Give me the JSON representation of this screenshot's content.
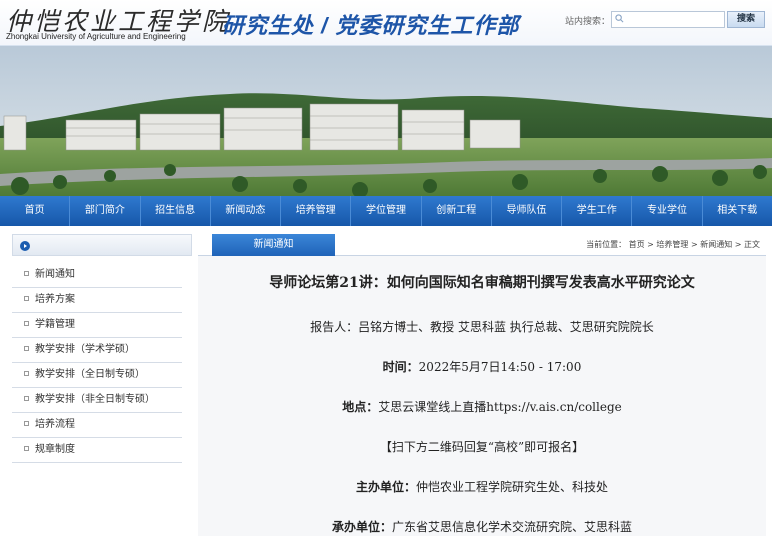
{
  "header": {
    "logo_cn": "仲恺农业工程学院",
    "logo_en": "Zhongkai University of Agriculture and Engineering",
    "site_title": "研究生处 / 党委研究生工作部",
    "search_label": "站内搜索：",
    "search_placeholder": "",
    "search_button": "搜索"
  },
  "nav": {
    "items": [
      "首页",
      "部门简介",
      "招生信息",
      "新闻动态",
      "培养管理",
      "学位管理",
      "创新工程",
      "导师队伍",
      "学生工作",
      "专业学位",
      "相关下载"
    ]
  },
  "sidebar": {
    "items": [
      "新闻通知",
      "培养方案",
      "学籍管理",
      "教学安排（学术学硕）",
      "教学安排（全日制专硕）",
      "教学安排（非全日制专硕）",
      "培养流程",
      "规章制度"
    ]
  },
  "main": {
    "tab": "新闻通知",
    "breadcrumb": "当前位置： 首页 > 培养管理 > 新闻通知 > 正文",
    "title": "导师论坛第21讲：如何向国际知名审稿期刊撰写发表高水平研究论文",
    "reporter": "报告人：吕铭方博士、教授  艾思科蓝  执行总裁、艾思研究院院长",
    "time_label": "时间：",
    "time_value": "2022年5月7日14:50 - 17:00",
    "place_label": "地点：",
    "place_value": "艾思云课堂线上直播https://v.ais.cn/college",
    "register": "【扫下方二维码回复“高校”即可报名】",
    "host_label": "主办单位：",
    "host_value": "仲恺农业工程学院研究生处、科技处",
    "organizer_label": "承办单位：",
    "organizer_value": "广东省艾思信息化学术交流研究院、艾思科蓝"
  },
  "colors": {
    "nav_blue": "#1f63b8",
    "title_blue": "#1d55a8"
  }
}
